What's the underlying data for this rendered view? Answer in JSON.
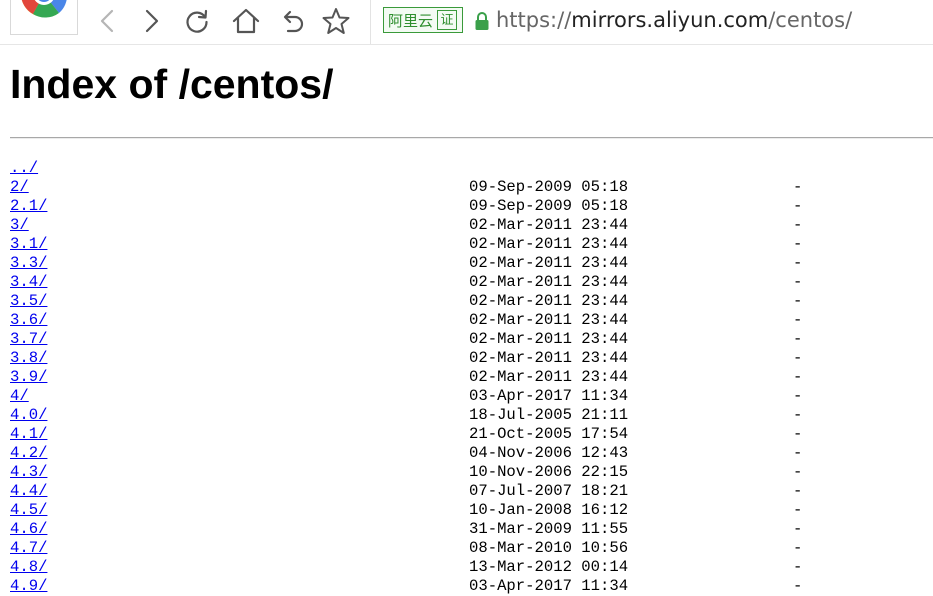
{
  "browser": {
    "badge_text": "阿里云",
    "badge_cert": "证",
    "url_protocol": "https://",
    "url_host": "mirrors.aliyun.com",
    "url_path": "/centos/"
  },
  "page": {
    "title": "Index of /centos/"
  },
  "listing": {
    "parent": "../",
    "entries": [
      {
        "name": "2/",
        "date": "09-Sep-2009 05:18",
        "size": "-"
      },
      {
        "name": "2.1/",
        "date": "09-Sep-2009 05:18",
        "size": "-"
      },
      {
        "name": "3/",
        "date": "02-Mar-2011 23:44",
        "size": "-"
      },
      {
        "name": "3.1/",
        "date": "02-Mar-2011 23:44",
        "size": "-"
      },
      {
        "name": "3.3/",
        "date": "02-Mar-2011 23:44",
        "size": "-"
      },
      {
        "name": "3.4/",
        "date": "02-Mar-2011 23:44",
        "size": "-"
      },
      {
        "name": "3.5/",
        "date": "02-Mar-2011 23:44",
        "size": "-"
      },
      {
        "name": "3.6/",
        "date": "02-Mar-2011 23:44",
        "size": "-"
      },
      {
        "name": "3.7/",
        "date": "02-Mar-2011 23:44",
        "size": "-"
      },
      {
        "name": "3.8/",
        "date": "02-Mar-2011 23:44",
        "size": "-"
      },
      {
        "name": "3.9/",
        "date": "02-Mar-2011 23:44",
        "size": "-"
      },
      {
        "name": "4/",
        "date": "03-Apr-2017 11:34",
        "size": "-"
      },
      {
        "name": "4.0/",
        "date": "18-Jul-2005 21:11",
        "size": "-"
      },
      {
        "name": "4.1/",
        "date": "21-Oct-2005 17:54",
        "size": "-"
      },
      {
        "name": "4.2/",
        "date": "04-Nov-2006 12:43",
        "size": "-"
      },
      {
        "name": "4.3/",
        "date": "10-Nov-2006 22:15",
        "size": "-"
      },
      {
        "name": "4.4/",
        "date": "07-Jul-2007 18:21",
        "size": "-"
      },
      {
        "name": "4.5/",
        "date": "10-Jan-2008 16:12",
        "size": "-"
      },
      {
        "name": "4.6/",
        "date": "31-Mar-2009 11:55",
        "size": "-"
      },
      {
        "name": "4.7/",
        "date": "08-Mar-2010 10:56",
        "size": "-"
      },
      {
        "name": "4.8/",
        "date": "13-Mar-2012 00:14",
        "size": "-"
      },
      {
        "name": "4.9/",
        "date": "03-Apr-2017 11:34",
        "size": "-"
      }
    ]
  },
  "icons": {
    "logo": "browser-logo-icon",
    "back": "back-arrow-icon",
    "forward": "forward-arrow-icon",
    "reload": "reload-icon",
    "home": "home-icon",
    "undo": "undo-icon",
    "favorite": "star-icon",
    "secure": "lock-icon"
  },
  "colors": {
    "link": "#0000ee",
    "badge_green": "#2f8f2f",
    "lock_green": "#3aa04a"
  }
}
